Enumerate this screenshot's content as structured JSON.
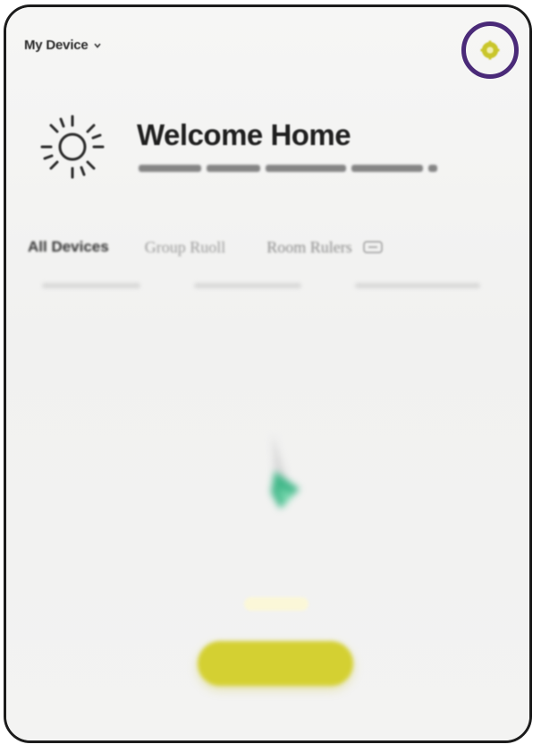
{
  "header": {
    "device_selector_label": "My Device",
    "settings_icon": "gear-icon",
    "settings_highlight_color": "#4a2a78",
    "accent_color": "#d4d032"
  },
  "welcome": {
    "icon": "sun-icon",
    "title": "Welcome Home"
  },
  "tabs": [
    {
      "label": "All Devices",
      "selected": true
    }
  ],
  "empty_state": {
    "illustration": "empty-devices-illustration"
  }
}
